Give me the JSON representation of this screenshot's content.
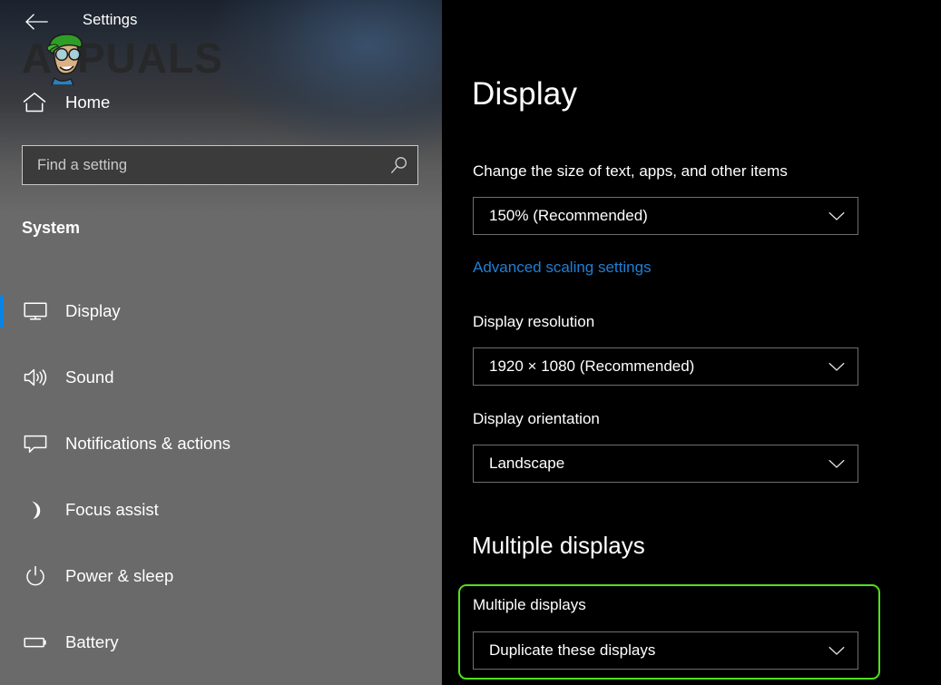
{
  "window": {
    "title": "Settings",
    "back_icon": "back-arrow-icon"
  },
  "watermark": {
    "text": "APPUALS",
    "character_icon": "appuals-mascot-icon"
  },
  "sidebar": {
    "home": {
      "label": "Home",
      "icon": "home-icon"
    },
    "search": {
      "placeholder": "Find a setting",
      "value": "",
      "icon": "search-icon"
    },
    "section_heading": "System",
    "items": [
      {
        "label": "Display",
        "icon": "monitor-icon",
        "selected": true
      },
      {
        "label": "Sound",
        "icon": "speaker-icon",
        "selected": false
      },
      {
        "label": "Notifications & actions",
        "icon": "notification-bubble-icon",
        "selected": false
      },
      {
        "label": "Focus assist",
        "icon": "moon-icon",
        "selected": false
      },
      {
        "label": "Power & sleep",
        "icon": "power-icon",
        "selected": false
      },
      {
        "label": "Battery",
        "icon": "battery-icon",
        "selected": false
      }
    ]
  },
  "main": {
    "page_title": "Display",
    "scale": {
      "label": "Change the size of text, apps, and other items",
      "value": "150% (Recommended)",
      "chevron_icon": "chevron-down-icon"
    },
    "advanced_link": "Advanced scaling settings",
    "resolution": {
      "label": "Display resolution",
      "value": "1920 × 1080 (Recommended)",
      "chevron_icon": "chevron-down-icon"
    },
    "orientation": {
      "label": "Display orientation",
      "value": "Landscape",
      "chevron_icon": "chevron-down-icon"
    },
    "multiple_displays": {
      "section_heading": "Multiple displays",
      "label": "Multiple displays",
      "value": "Duplicate these displays",
      "chevron_icon": "chevron-down-icon"
    }
  },
  "colors": {
    "accent_blue": "#0a84e4",
    "link_blue": "#1f7fd6",
    "highlight_green": "#4fe01c",
    "sidebar_gray": "#6a6a6a",
    "panel_black": "#000000"
  }
}
